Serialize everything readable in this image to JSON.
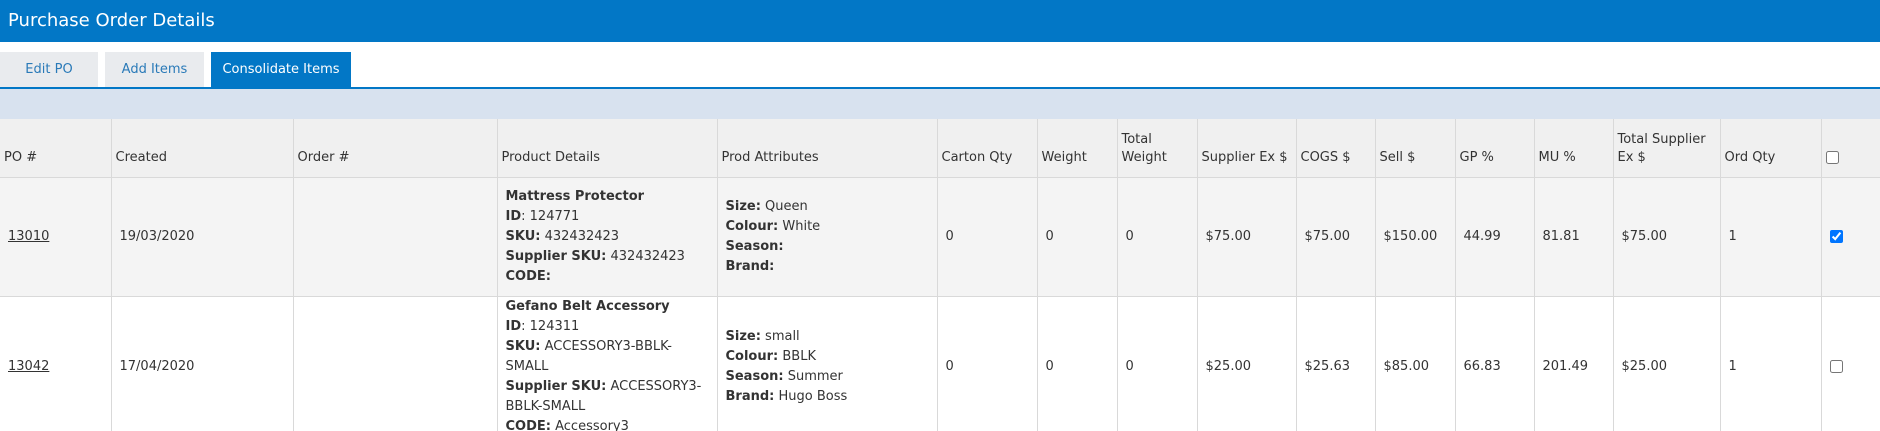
{
  "header": {
    "title": "Purchase Order Details"
  },
  "tabs": [
    {
      "label": "Edit PO",
      "active": false
    },
    {
      "label": "Add Items",
      "active": false
    },
    {
      "label": "Consolidate Items",
      "active": true
    }
  ],
  "table": {
    "columns": [
      "PO #",
      "Created",
      "Order #",
      "Product Details",
      "Prod Attributes",
      "Carton Qty",
      "Weight",
      "Total Weight",
      "Supplier Ex $",
      "COGS $",
      "Sell $",
      "GP %",
      "MU %",
      "Total Supplier Ex $",
      "Ord Qty"
    ],
    "select_all_checked": false,
    "rows": [
      {
        "po": "13010",
        "created": "19/03/2020",
        "order": "",
        "product_name": "Mattress Protector",
        "id_label": "ID",
        "id": "124771",
        "sku_label": "SKU:",
        "sku": "432432423",
        "supplier_sku_label": "Supplier SKU:",
        "supplier_sku": "432432423",
        "code_label": "CODE:",
        "code": "",
        "size_label": "Size:",
        "size": "Queen",
        "colour_label": "Colour:",
        "colour": "White",
        "season_label": "Season:",
        "season": "",
        "brand_label": "Brand:",
        "brand": "",
        "carton_qty": "0",
        "weight": "0",
        "total_weight": "0",
        "supplier_ex": "$75.00",
        "cogs": "$75.00",
        "sell": "$150.00",
        "gp": "44.99",
        "mu": "81.81",
        "total_supplier_ex": "$75.00",
        "ord_qty": "1",
        "checked": true
      },
      {
        "po": "13042",
        "created": "17/04/2020",
        "order": "",
        "product_name": "Gefano Belt Accessory",
        "id_label": "ID",
        "id": "124311",
        "sku_label": "SKU:",
        "sku": "ACCESSORY3-BBLK-SMALL",
        "supplier_sku_label": "Supplier SKU:",
        "supplier_sku": "ACCESSORY3-BBLK-SMALL",
        "code_label": "CODE:",
        "code": "Accessory3",
        "size_label": "Size:",
        "size": "small",
        "colour_label": "Colour:",
        "colour": "BBLK",
        "season_label": "Season:",
        "season": "Summer",
        "brand_label": "Brand:",
        "brand": "Hugo Boss",
        "carton_qty": "0",
        "weight": "0",
        "total_weight": "0",
        "supplier_ex": "$25.00",
        "cogs": "$25.63",
        "sell": "$85.00",
        "gp": "66.83",
        "mu": "201.49",
        "total_supplier_ex": "$25.00",
        "ord_qty": "1",
        "checked": false
      }
    ]
  },
  "colors": {
    "header_blue": "#0277c6",
    "toolbar_band": "#d8e2ef",
    "row_alt": "#f4f4f4"
  }
}
